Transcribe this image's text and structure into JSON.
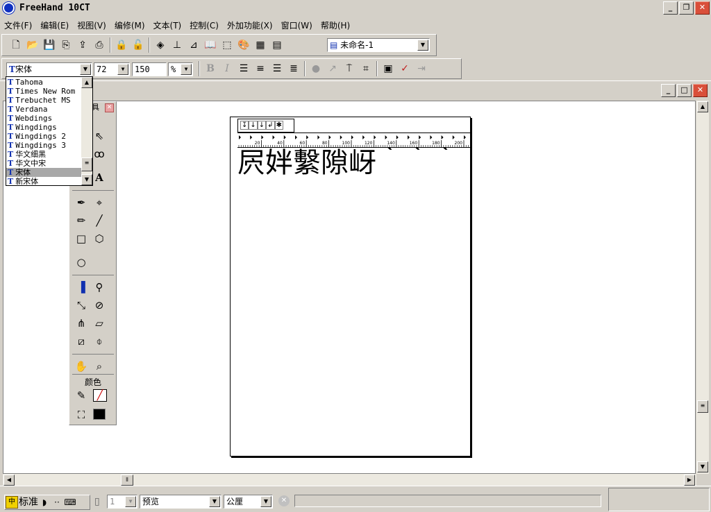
{
  "app": {
    "title": "FreeHand 10CT"
  },
  "menu": [
    "文件(F)",
    "编辑(E)",
    "视图(V)",
    "编修(M)",
    "文本(T)",
    "控制(C)",
    "外加功能(X)",
    "窗口(W)",
    "帮助(H)"
  ],
  "toolbar": {
    "document_select": "未命名-1"
  },
  "text_toolbar": {
    "font": "宋体",
    "size": "72",
    "leading": "150",
    "leading_unit": "%"
  },
  "font_list": {
    "items": [
      "Tahoma",
      "Times New Rom",
      "Trebuchet MS",
      "Verdana",
      "Webdings",
      "Wingdings",
      "Wingdings 2",
      "Wingdings 3",
      "华文细黑",
      "华文中宋",
      "宋体",
      "新宋体"
    ],
    "selected": "宋体"
  },
  "toolbox": {
    "title_fragment": "具",
    "color_section": "颜色"
  },
  "canvas": {
    "text": "屄姅繫隙岈｀｀｀",
    "ruler_ticks": [
      "20",
      "40",
      "60",
      "80",
      "100",
      "120",
      "140",
      "160",
      "180",
      "200"
    ]
  },
  "status": {
    "ime_label": "标准",
    "page": "1",
    "view_mode": "预览",
    "units": "公厘"
  }
}
